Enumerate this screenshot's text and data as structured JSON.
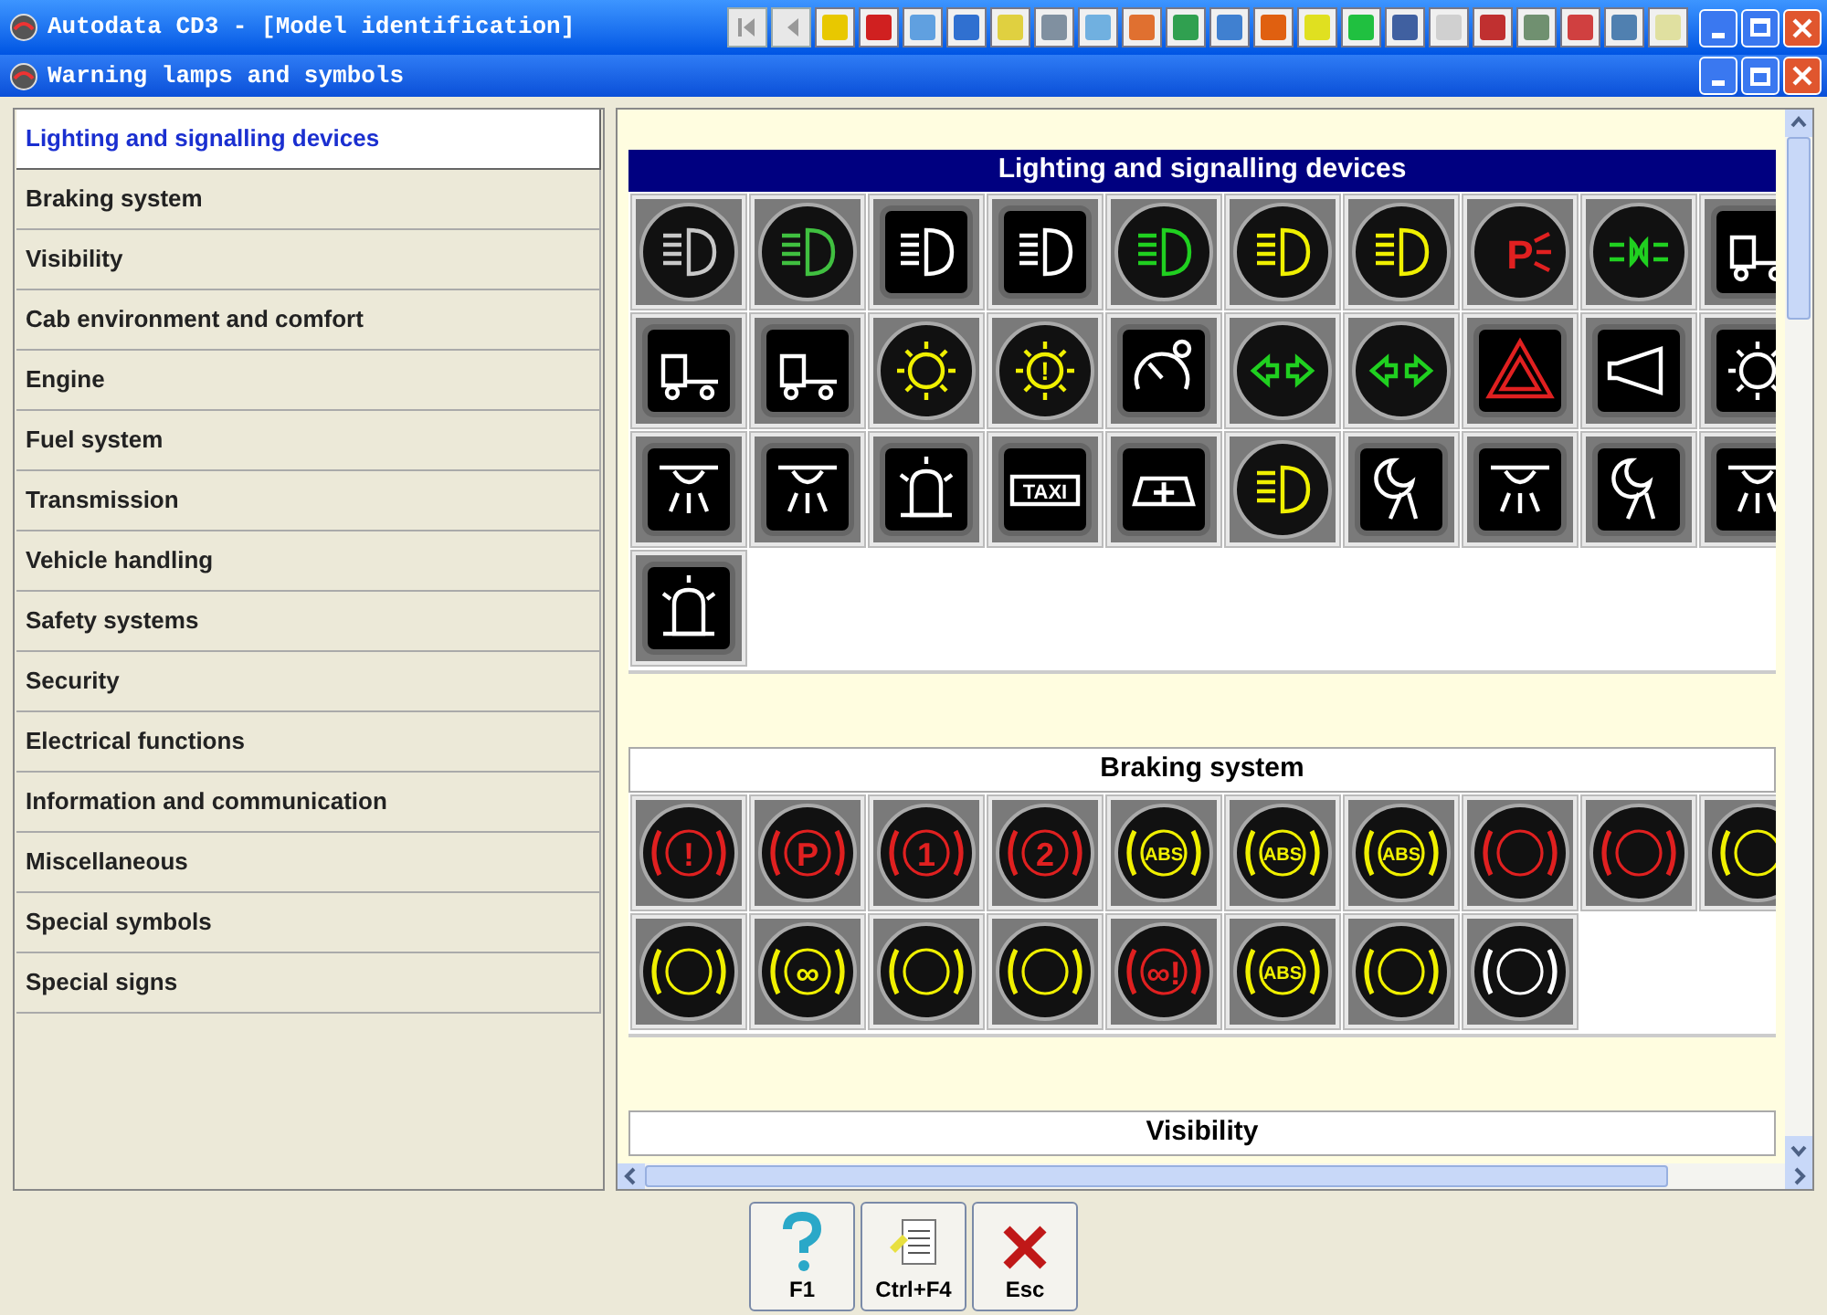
{
  "app_window": {
    "title": "Autodata CD3 - [Model identification]"
  },
  "toolbar": [
    {
      "kind": "first"
    },
    {
      "kind": "prev"
    },
    {
      "kind": "tool",
      "color": "#e8c800"
    },
    {
      "kind": "tool",
      "color": "#d02020"
    },
    {
      "kind": "tool",
      "color": "#60a0e0"
    },
    {
      "kind": "tool",
      "color": "#3070d0"
    },
    {
      "kind": "tool",
      "color": "#e0d040"
    },
    {
      "kind": "tool",
      "color": "#8090a0"
    },
    {
      "kind": "tool",
      "color": "#70b0e0"
    },
    {
      "kind": "tool",
      "color": "#e07030"
    },
    {
      "kind": "tool",
      "color": "#30a050"
    },
    {
      "kind": "tool",
      "color": "#4080d0"
    },
    {
      "kind": "tool",
      "color": "#e06010"
    },
    {
      "kind": "tool",
      "color": "#e0e020"
    },
    {
      "kind": "tool",
      "color": "#20c040"
    },
    {
      "kind": "tool",
      "color": "#4060a0"
    },
    {
      "kind": "tool",
      "color": "#d0d0d0"
    },
    {
      "kind": "tool",
      "color": "#c03030"
    },
    {
      "kind": "tool",
      "color": "#709070"
    },
    {
      "kind": "tool",
      "color": "#d04040"
    },
    {
      "kind": "tool",
      "color": "#5080b0"
    },
    {
      "kind": "tool",
      "color": "#e0e0a0"
    }
  ],
  "child_window": {
    "title": "Warning lamps and symbols"
  },
  "sidebar": {
    "items": [
      {
        "label": "Lighting and signalling devices",
        "selected": true
      },
      {
        "label": "Braking system",
        "selected": false
      },
      {
        "label": "Visibility",
        "selected": false
      },
      {
        "label": "Cab environment and comfort",
        "selected": false
      },
      {
        "label": "Engine",
        "selected": false
      },
      {
        "label": "Fuel system",
        "selected": false
      },
      {
        "label": "Transmission",
        "selected": false
      },
      {
        "label": "Vehicle handling",
        "selected": false
      },
      {
        "label": "Safety systems",
        "selected": false
      },
      {
        "label": "Security",
        "selected": false
      },
      {
        "label": "Electrical functions",
        "selected": false
      },
      {
        "label": "Information and communication",
        "selected": false
      },
      {
        "label": "Miscellaneous",
        "selected": false
      },
      {
        "label": "Special symbols",
        "selected": false
      },
      {
        "label": "Special signs",
        "selected": false
      }
    ]
  },
  "sections": [
    {
      "title": "Lighting and signalling devices",
      "highlighted": true,
      "rows": [
        [
          {
            "kind": "headlamp",
            "round": true,
            "color": "#c8c8c8"
          },
          {
            "kind": "headlamp",
            "round": true,
            "color": "#40c040"
          },
          {
            "kind": "headlamp",
            "round": false,
            "color": "#ffffff"
          },
          {
            "kind": "headlamp",
            "round": false,
            "color": "#ffffff"
          },
          {
            "kind": "headlamp",
            "round": true,
            "color": "#20d020"
          },
          {
            "kind": "headlamp",
            "round": true,
            "color": "#f0f000"
          },
          {
            "kind": "headlamp",
            "round": true,
            "color": "#f0f000"
          },
          {
            "kind": "letter",
            "round": true,
            "color": "#e02020",
            "glyph": "P"
          },
          {
            "kind": "sidelight",
            "round": true,
            "color": "#20d020"
          },
          {
            "kind": "truck",
            "round": false,
            "color": "#ffffff"
          }
        ],
        [
          {
            "kind": "truck",
            "round": false,
            "color": "#ffffff"
          },
          {
            "kind": "truck",
            "round": false,
            "color": "#ffffff"
          },
          {
            "kind": "sun",
            "round": true,
            "color": "#f0f000"
          },
          {
            "kind": "sun",
            "round": true,
            "color": "#f0f000",
            "glyph": "!"
          },
          {
            "kind": "gauge",
            "round": false,
            "color": "#ffffff"
          },
          {
            "kind": "arrows",
            "round": true,
            "color": "#20d020"
          },
          {
            "kind": "arrows",
            "round": true,
            "color": "#20d020"
          },
          {
            "kind": "triangle",
            "round": false,
            "color": "#e02020"
          },
          {
            "kind": "horn",
            "round": false,
            "color": "#ffffff"
          },
          {
            "kind": "sun",
            "round": false,
            "color": "#ffffff"
          }
        ],
        [
          {
            "kind": "lamp",
            "round": false,
            "color": "#ffffff"
          },
          {
            "kind": "lamp",
            "round": false,
            "color": "#ffffff"
          },
          {
            "kind": "beacon",
            "round": false,
            "color": "#ffffff"
          },
          {
            "kind": "letter",
            "round": false,
            "color": "#ffffff",
            "glyph": "TAXI"
          },
          {
            "kind": "letter",
            "round": false,
            "color": "#ffffff",
            "glyph": "+"
          },
          {
            "kind": "headlamp",
            "round": true,
            "color": "#f0f000"
          },
          {
            "kind": "moon",
            "round": false,
            "color": "#ffffff"
          },
          {
            "kind": "lamp",
            "round": false,
            "color": "#ffffff"
          },
          {
            "kind": "moon",
            "round": false,
            "color": "#ffffff"
          },
          {
            "kind": "lamp",
            "round": false,
            "color": "#ffffff"
          }
        ],
        [
          {
            "kind": "beacon",
            "round": false,
            "color": "#ffffff"
          }
        ]
      ]
    },
    {
      "title": "Braking system",
      "highlighted": false,
      "rows": [
        [
          {
            "kind": "brake",
            "round": true,
            "color": "#e02020",
            "glyph": "!"
          },
          {
            "kind": "brake",
            "round": true,
            "color": "#e02020",
            "glyph": "P"
          },
          {
            "kind": "brake",
            "round": true,
            "color": "#e02020",
            "glyph": "1"
          },
          {
            "kind": "brake",
            "round": true,
            "color": "#e02020",
            "glyph": "2"
          },
          {
            "kind": "brake",
            "round": true,
            "color": "#f0f000",
            "glyph": "ABS"
          },
          {
            "kind": "brake",
            "round": true,
            "color": "#f0f000",
            "glyph": "ABS"
          },
          {
            "kind": "brake",
            "round": true,
            "color": "#f0f000",
            "glyph": "ABS"
          },
          {
            "kind": "brake",
            "round": true,
            "color": "#e02020"
          },
          {
            "kind": "brake",
            "round": true,
            "color": "#e02020"
          },
          {
            "kind": "brake",
            "round": true,
            "color": "#f0f000"
          }
        ],
        [
          {
            "kind": "brake",
            "round": true,
            "color": "#f0f000"
          },
          {
            "kind": "brake",
            "round": true,
            "color": "#f0f000",
            "glyph": "∞"
          },
          {
            "kind": "brake",
            "round": true,
            "color": "#f0f000"
          },
          {
            "kind": "brake",
            "round": true,
            "color": "#f0f000"
          },
          {
            "kind": "brake",
            "round": true,
            "color": "#e02020",
            "glyph": "∞!"
          },
          {
            "kind": "brake",
            "round": true,
            "color": "#f0f000",
            "glyph": "ABS"
          },
          {
            "kind": "brake",
            "round": true,
            "color": "#f0f000"
          },
          {
            "kind": "brake",
            "round": true,
            "color": "#ffffff"
          }
        ]
      ]
    },
    {
      "title": "Visibility",
      "highlighted": false
    }
  ],
  "bottom_buttons": [
    {
      "kind": "help",
      "label": "F1"
    },
    {
      "kind": "document",
      "label": "Ctrl+F4"
    },
    {
      "kind": "close",
      "label": "Esc"
    }
  ]
}
